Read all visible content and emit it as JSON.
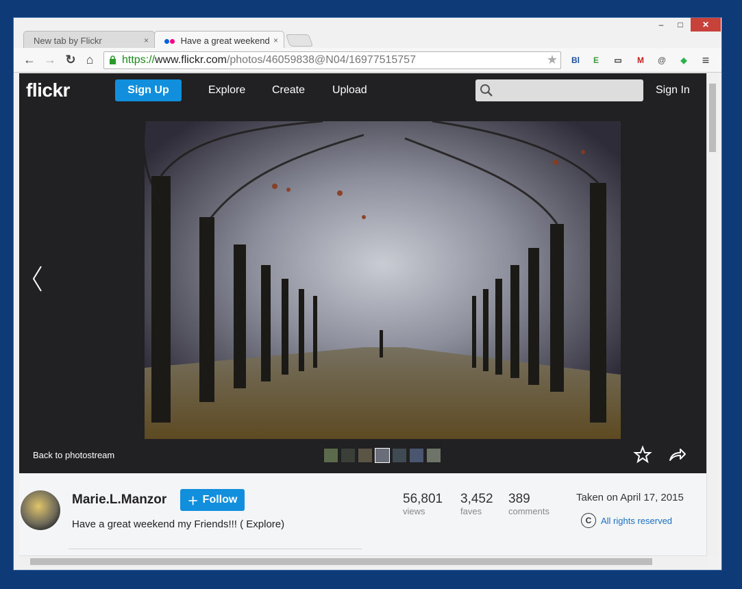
{
  "browser": {
    "tabs": [
      {
        "label": "New tab by Flickr",
        "close": "×"
      },
      {
        "label": "Have a great weekend",
        "close": "×"
      }
    ],
    "window_controls": {
      "min": "–",
      "max": "□",
      "close": "✕"
    },
    "url": {
      "scheme": "https://",
      "host": "www.flickr.com",
      "path": "/photos/46059838@N04/16977515757"
    },
    "nav_glyphs": {
      "back": "←",
      "forward": "→",
      "reload": "↻",
      "home": "⌂",
      "menu": "≡"
    },
    "extensions": [
      {
        "name": "bl-icon",
        "glyph": "Bl"
      },
      {
        "name": "evernote-icon",
        "glyph": "E"
      },
      {
        "name": "ruler-icon",
        "glyph": "▭"
      },
      {
        "name": "gmail-icon",
        "glyph": "M"
      },
      {
        "name": "email-icon",
        "glyph": "@"
      },
      {
        "name": "feedly-icon",
        "glyph": "◆"
      }
    ]
  },
  "flickr": {
    "logo": "flickr",
    "nav": {
      "signup": "Sign Up",
      "explore": "Explore",
      "create": "Create",
      "upload": "Upload",
      "signin": "Sign In"
    },
    "back_label": "Back to photostream",
    "owner": "Marie.L.Manzor",
    "follow_label": "Follow",
    "photo_title": "Have a great weekend my Friends!!! ( Explore)",
    "stats": {
      "views": {
        "value": "56,801",
        "label": "views"
      },
      "faves": {
        "value": "3,452",
        "label": "faves"
      },
      "comments": {
        "value": "389",
        "label": "comments"
      }
    },
    "taken": "Taken on April 17, 2015",
    "rights": "All rights reserved",
    "thumbnail_count": 7,
    "selected_thumbnail": 3
  },
  "colors": {
    "accent": "#128fdc",
    "nav_bg": "#212124",
    "link": "#1a6fc4"
  }
}
